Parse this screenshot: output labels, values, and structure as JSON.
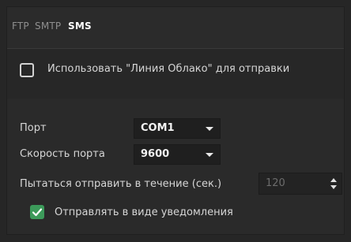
{
  "tabs": [
    {
      "label": "FTP",
      "active": false
    },
    {
      "label": "SMTP",
      "active": false
    },
    {
      "label": "SMS",
      "active": true
    }
  ],
  "use_cloud": {
    "label": "Использовать \"Линия Облако\" для отправки",
    "checked": false
  },
  "port": {
    "label": "Порт",
    "value": "COM1"
  },
  "port_speed": {
    "label": "Скорость порта",
    "value": "9600"
  },
  "retry": {
    "label": "Пытаться отправить в течение (сек.)",
    "value": "120"
  },
  "notify": {
    "label": "Отправлять в виде уведомления",
    "checked": true
  },
  "colors": {
    "accent_check": "#3c9a5a",
    "background": "#262626",
    "active_tab": "#ffffff"
  }
}
